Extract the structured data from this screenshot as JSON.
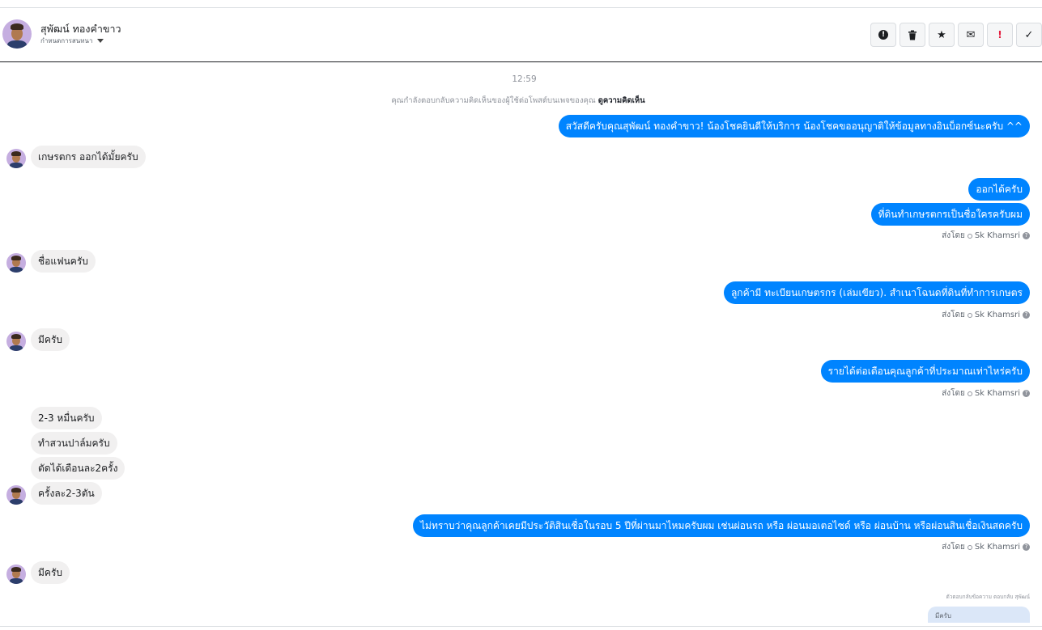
{
  "header": {
    "contact_name": "สุพัฒน์ ทองคำขาว",
    "subtitle": "กำหนดการสนทนา",
    "actions": [
      {
        "name": "info-button",
        "icon": "info-icon",
        "glyph": "!"
      },
      {
        "name": "delete-button",
        "icon": "trash-icon",
        "glyph": "🗑"
      },
      {
        "name": "star-button",
        "icon": "star-icon",
        "glyph": "★"
      },
      {
        "name": "mail-button",
        "icon": "mail-icon",
        "glyph": "✉"
      },
      {
        "name": "spam-button",
        "icon": "exclamation-icon",
        "glyph": "!"
      },
      {
        "name": "done-button",
        "icon": "check-icon",
        "glyph": "✓"
      }
    ]
  },
  "conversation": {
    "time": "12:59",
    "note_prefix": "คุณกำลังตอบกลับความคิดเห็นของผู้ใช้ต่อโพสต์บนเพจของคุณ",
    "note_link": "ดูความคิดเห็น",
    "messages": {
      "m1": "สวัสดีครับคุณสุพัฒน์ ทองคำขาว! น้องโชคยินดีให้บริการ น้องโชคขออนุญาติให้ข้อมูลทางอินบ็อกซ์นะครับ ^^",
      "m2": "เกษรตกร ออกได้มั้ยครับ",
      "m3": "ออกได้ครับ",
      "m4": "ที่ดินทำเกษรตกรเป็นชื่อใครครับผม",
      "m5": "ชื่อแฟนครับ",
      "m6": "ลูกค้ามี ทะเบียนเกษตรกร (เล่มเขียว). สำเนาโฉนดที่ดินที่ทำการเกษตร",
      "m7": "มีครับ",
      "m8": "รายได้ต่อเดือนคุณลูกค้าที่ประมาณเท่าไหร่ครับ",
      "m9": "2-3 หมื่นครับ",
      "m10": "ทำสวนปาล์มครับ",
      "m11": "ตัดได้เดือนละ2ครั้ง",
      "m12": "ครั้งละ2-3ตัน",
      "m13": "ไม่ทราบว่าคุณลูกค้าเคยมีประวัติสินเชื่อในรอบ 5 ปีที่ผ่านมาไหมครับผม เช่นผ่อนรถ หรือ ผ่อนมอเตอไซด์ หรือ ผ่อนบ้าน หรือผ่อนสินเชื่อเงินสดครับ",
      "m14": "มีครับ"
    },
    "sent_by_prefix": "ส่งโดย",
    "sent_by_name": "Sk Khamsri",
    "reply_label": "ตัวตอบกลับข้อความ ตอบกลับ สุพัฒน์",
    "reply_preview": "มีครับ"
  },
  "colors": {
    "outgoing": "#0084ff",
    "incoming": "#f1f0f0"
  }
}
